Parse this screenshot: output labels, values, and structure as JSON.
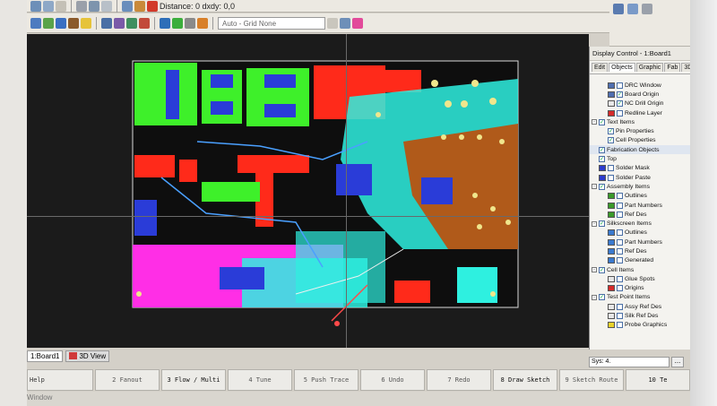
{
  "toolbar": {
    "top_text": "Distance: 0 dxdy: 0,0",
    "grid_combo": "Auto - Grid None"
  },
  "panel": {
    "title": "Display Control - 1:Board1",
    "tabs": [
      "Edit",
      "Objects",
      "Graphic",
      "Fab",
      "3D"
    ],
    "active_tab": "Objects",
    "rows": [
      {
        "label": "DRC Window",
        "indent": 1,
        "checked": false,
        "swatch": "#4f6fb0",
        "expander": ""
      },
      {
        "label": "Board Origin",
        "indent": 1,
        "checked": true,
        "swatch": "#4f6fb0",
        "expander": ""
      },
      {
        "label": "NC Drill Origin",
        "indent": 1,
        "checked": true,
        "swatch": "#e8e8e8",
        "expander": ""
      },
      {
        "label": "Redline Layer",
        "indent": 1,
        "checked": false,
        "swatch": "#d62b2b",
        "expander": ""
      },
      {
        "label": "Text Items",
        "indent": 0,
        "checked": true,
        "swatch": "",
        "expander": "-"
      },
      {
        "label": "Pin Properties",
        "indent": 1,
        "checked": true,
        "swatch": "",
        "expander": ""
      },
      {
        "label": "Cell Properties",
        "indent": 1,
        "checked": true,
        "swatch": "",
        "expander": ""
      },
      {
        "label": "Fabrication Objects",
        "indent": 0,
        "checked": true,
        "swatch": "",
        "expander": "",
        "header": true
      },
      {
        "label": "Top",
        "indent": 0,
        "checked": true,
        "swatch": "",
        "expander": ""
      },
      {
        "label": "Solder Mask",
        "indent": 0,
        "checked": false,
        "swatch": "#2c3ccc",
        "expander": ""
      },
      {
        "label": "Solder Paste",
        "indent": 0,
        "checked": false,
        "swatch": "#2c3ccc",
        "expander": ""
      },
      {
        "label": "Assembly Items",
        "indent": 0,
        "checked": true,
        "swatch": "",
        "expander": "-"
      },
      {
        "label": "Outlines",
        "indent": 1,
        "checked": false,
        "swatch": "#3a9a2a",
        "expander": ""
      },
      {
        "label": "Part Numbers",
        "indent": 1,
        "checked": false,
        "swatch": "#3a9a2a",
        "expander": ""
      },
      {
        "label": "Ref Des",
        "indent": 1,
        "checked": false,
        "swatch": "#3a9a2a",
        "expander": ""
      },
      {
        "label": "Silkscreen Items",
        "indent": 0,
        "checked": true,
        "swatch": "",
        "expander": "-"
      },
      {
        "label": "Outlines",
        "indent": 1,
        "checked": false,
        "swatch": "#3a7ad0",
        "expander": ""
      },
      {
        "label": "Part Numbers",
        "indent": 1,
        "checked": false,
        "swatch": "#3a7ad0",
        "expander": ""
      },
      {
        "label": "Ref Des",
        "indent": 1,
        "checked": false,
        "swatch": "#3a7ad0",
        "expander": ""
      },
      {
        "label": "Generated",
        "indent": 1,
        "checked": false,
        "swatch": "#3a7ad0",
        "expander": ""
      },
      {
        "label": "Cell Items",
        "indent": 0,
        "checked": true,
        "swatch": "",
        "expander": "-"
      },
      {
        "label": "Glue Spots",
        "indent": 1,
        "checked": false,
        "swatch": "#e8e8e8",
        "expander": ""
      },
      {
        "label": "Origins",
        "indent": 1,
        "checked": false,
        "swatch": "#d62b2b",
        "expander": ""
      },
      {
        "label": "Test Point Items",
        "indent": 0,
        "checked": true,
        "swatch": "",
        "expander": "-"
      },
      {
        "label": "Assy Ref Des",
        "indent": 1,
        "checked": false,
        "swatch": "#e8e8e8",
        "expander": ""
      },
      {
        "label": "Silk Ref Des",
        "indent": 1,
        "checked": false,
        "swatch": "#e8e8e8",
        "expander": ""
      },
      {
        "label": "Probe Graphics",
        "indent": 1,
        "checked": false,
        "swatch": "#e8d22a",
        "expander": ""
      }
    ]
  },
  "view_tabs": {
    "board": "1:Board1",
    "view3d": "3D View"
  },
  "sys": {
    "label": "Sys: 4.",
    "more": "..."
  },
  "function_keys": [
    "Help",
    "2 Fanout",
    "3 Flow / Multi",
    "4 Tune",
    "5 Push Trace",
    "6 Undo",
    "7 Redo",
    "8 Draw Sketch",
    "9 Sketch Route",
    "10 Te"
  ],
  "status": {
    "text": "Window"
  },
  "colors": {
    "board_bg": "#1b1b1b",
    "copper_red": "#ff2a1a",
    "copper_green": "#3ef02a",
    "copper_cyan": "#2ef0e0",
    "copper_blue": "#2a3cd8",
    "copper_magenta": "#ff2ee6",
    "copper_brown": "#b05a1a"
  }
}
